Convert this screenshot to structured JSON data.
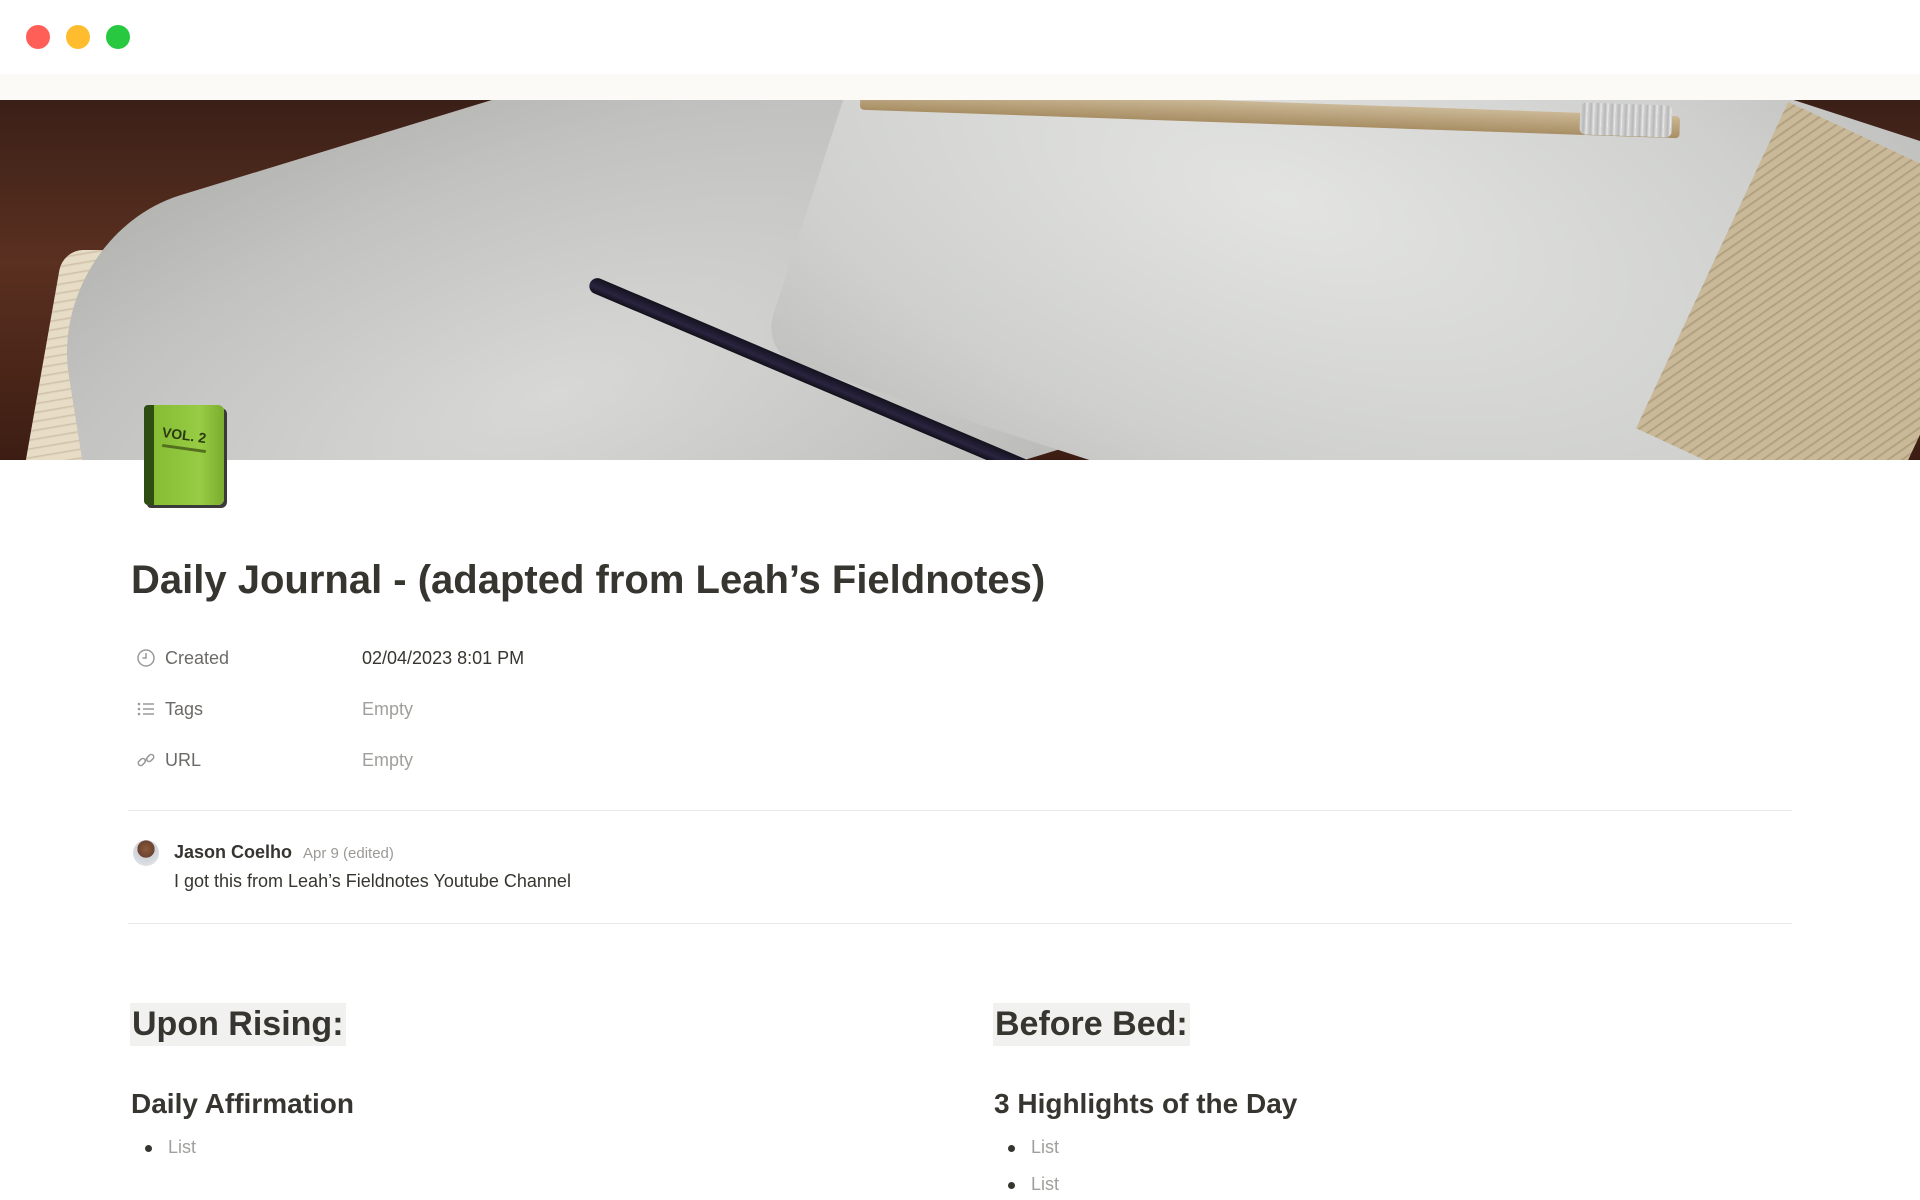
{
  "window": {
    "controls": [
      "close",
      "minimize",
      "zoom"
    ]
  },
  "cover": {
    "description_icon": "cover-image"
  },
  "page": {
    "icon": "green-book-icon",
    "icon_text": "VOL. 2",
    "title": "Daily Journal - (adapted from Leah’s Fieldnotes)"
  },
  "properties": [
    {
      "name": "Created",
      "value": "02/04/2023 8:01 PM",
      "icon": "clock-icon"
    },
    {
      "name": "Tags",
      "value": "Empty",
      "icon": "list-icon"
    },
    {
      "name": "URL",
      "value": "Empty",
      "icon": "link-icon"
    }
  ],
  "comment": {
    "author": "Jason Coelho",
    "date": "Apr 9 (edited)",
    "text": "I got this from Leah’s Fieldnotes Youtube Channel"
  },
  "left_column": {
    "heading": "Upon Rising:",
    "subheading": "Daily Affirmation",
    "items": [
      "List"
    ]
  },
  "right_column": {
    "heading": "Before Bed:",
    "subheading": "3 Highlights of the Day",
    "items": [
      "List",
      "List"
    ]
  },
  "colors": {
    "text": "#37352f",
    "muted": "#a09f9b",
    "heading_bg": "#f1f1ef"
  }
}
